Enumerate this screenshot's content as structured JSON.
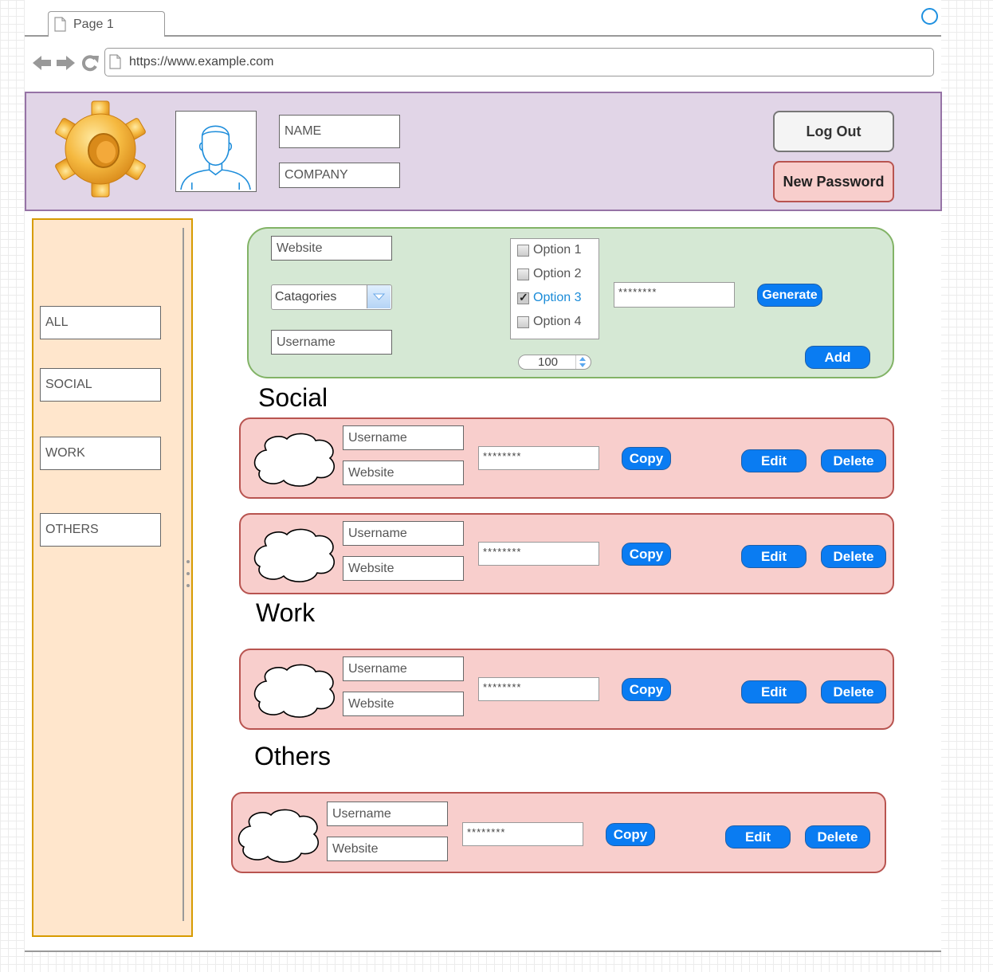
{
  "browser": {
    "tab_label": "Page 1",
    "url": "https://www.example.com"
  },
  "header": {
    "name_label": "NAME",
    "company_label": "COMPANY",
    "logout_label": "Log Out",
    "new_password_label": "New Password"
  },
  "sidebar": {
    "items": [
      {
        "label": "ALL"
      },
      {
        "label": "SOCIAL"
      },
      {
        "label": "WORK"
      },
      {
        "label": "OTHERS"
      }
    ]
  },
  "add_form": {
    "website_label": "Website",
    "categories_label": "Catagories",
    "username_label": "Username",
    "options": [
      {
        "label": "Option 1",
        "checked": false
      },
      {
        "label": "Option 2",
        "checked": false
      },
      {
        "label": "Option 3",
        "checked": true
      },
      {
        "label": "Option 4",
        "checked": false
      }
    ],
    "password_value": "********",
    "generate_label": "Generate",
    "length_value": "100",
    "add_label": "Add"
  },
  "sections": {
    "social_title": "Social",
    "work_title": "Work",
    "others_title": "Others"
  },
  "entries": [
    {
      "username": "Username",
      "website": "Website",
      "password": "********",
      "copy": "Copy",
      "edit": "Edit",
      "delete": "Delete"
    },
    {
      "username": "Username",
      "website": "Website",
      "password": "********",
      "copy": "Copy",
      "edit": "Edit",
      "delete": "Delete"
    },
    {
      "username": "Username",
      "website": "Website",
      "password": "********",
      "copy": "Copy",
      "edit": "Edit",
      "delete": "Delete"
    },
    {
      "username": "Username",
      "website": "Website",
      "password": "********",
      "copy": "Copy",
      "edit": "Edit",
      "delete": "Delete"
    }
  ],
  "colors": {
    "header_bg": "#e1d5e7",
    "sidebar_bg": "#ffe6cc",
    "form_bg": "#d5e8d4",
    "entry_bg": "#f8cecc",
    "button_blue": "#0a7cf2"
  }
}
